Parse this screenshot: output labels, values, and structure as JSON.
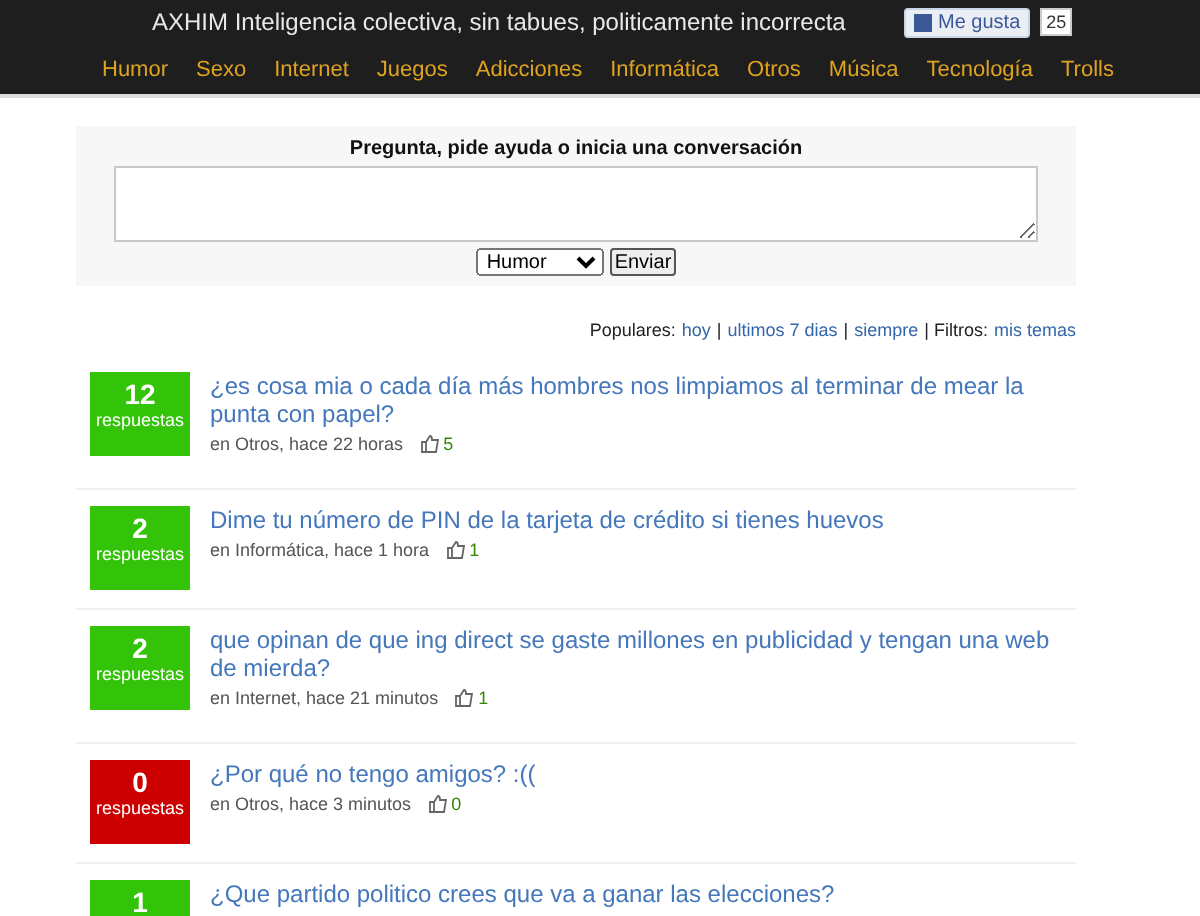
{
  "header": {
    "title": "AXHIM Inteligencia colectiva, sin tabues, politicamente incorrecta",
    "like_button": "Me gusta",
    "like_count": "25"
  },
  "nav": [
    "Humor",
    "Sexo",
    "Internet",
    "Juegos",
    "Adicciones",
    "Informática",
    "Otros",
    "Música",
    "Tecnología",
    "Trolls"
  ],
  "ask_form": {
    "heading": "Pregunta, pide ayuda o inicia una conversación",
    "category": "Humor",
    "submit": "Enviar"
  },
  "filters": [
    {
      "kind": "text",
      "text": "Populares:"
    },
    {
      "kind": "link",
      "text": "hoy"
    },
    {
      "kind": "text",
      "text": "|"
    },
    {
      "kind": "link",
      "text": "ultimos 7 dias"
    },
    {
      "kind": "text",
      "text": "|"
    },
    {
      "kind": "link",
      "text": "siempre"
    },
    {
      "kind": "text",
      "text": "| Filtros:"
    },
    {
      "kind": "link",
      "text": "mis temas"
    }
  ],
  "questions": [
    {
      "count": "12",
      "label": "respuestas",
      "color": "#33c40a",
      "title": "¿es cosa mia o cada día más hombres nos limpiamos al terminar de mear la punta con papel?",
      "meta": "en Otros, hace 22 horas",
      "votes": "5"
    },
    {
      "count": "2",
      "label": "respuestas",
      "color": "#33c40a",
      "title": "Dime tu número de PIN de la tarjeta de crédito si tienes huevos",
      "meta": "en Informática, hace 1 hora",
      "votes": "1"
    },
    {
      "count": "2",
      "label": "respuestas",
      "color": "#33c40a",
      "title": "que opinan de que ing direct se gaste millones en publicidad y tengan una web de mierda?",
      "meta": "en Internet, hace 21 minutos",
      "votes": "1"
    },
    {
      "count": "0",
      "label": "respuestas",
      "color": "#cc0000",
      "title": "¿Por qué no tengo amigos? :((",
      "meta": "en Otros, hace 3 minutos",
      "votes": "0"
    },
    {
      "count": "1",
      "color": "#33c40a",
      "title": "¿Que partido politico crees que va a ganar las elecciones?"
    }
  ]
}
